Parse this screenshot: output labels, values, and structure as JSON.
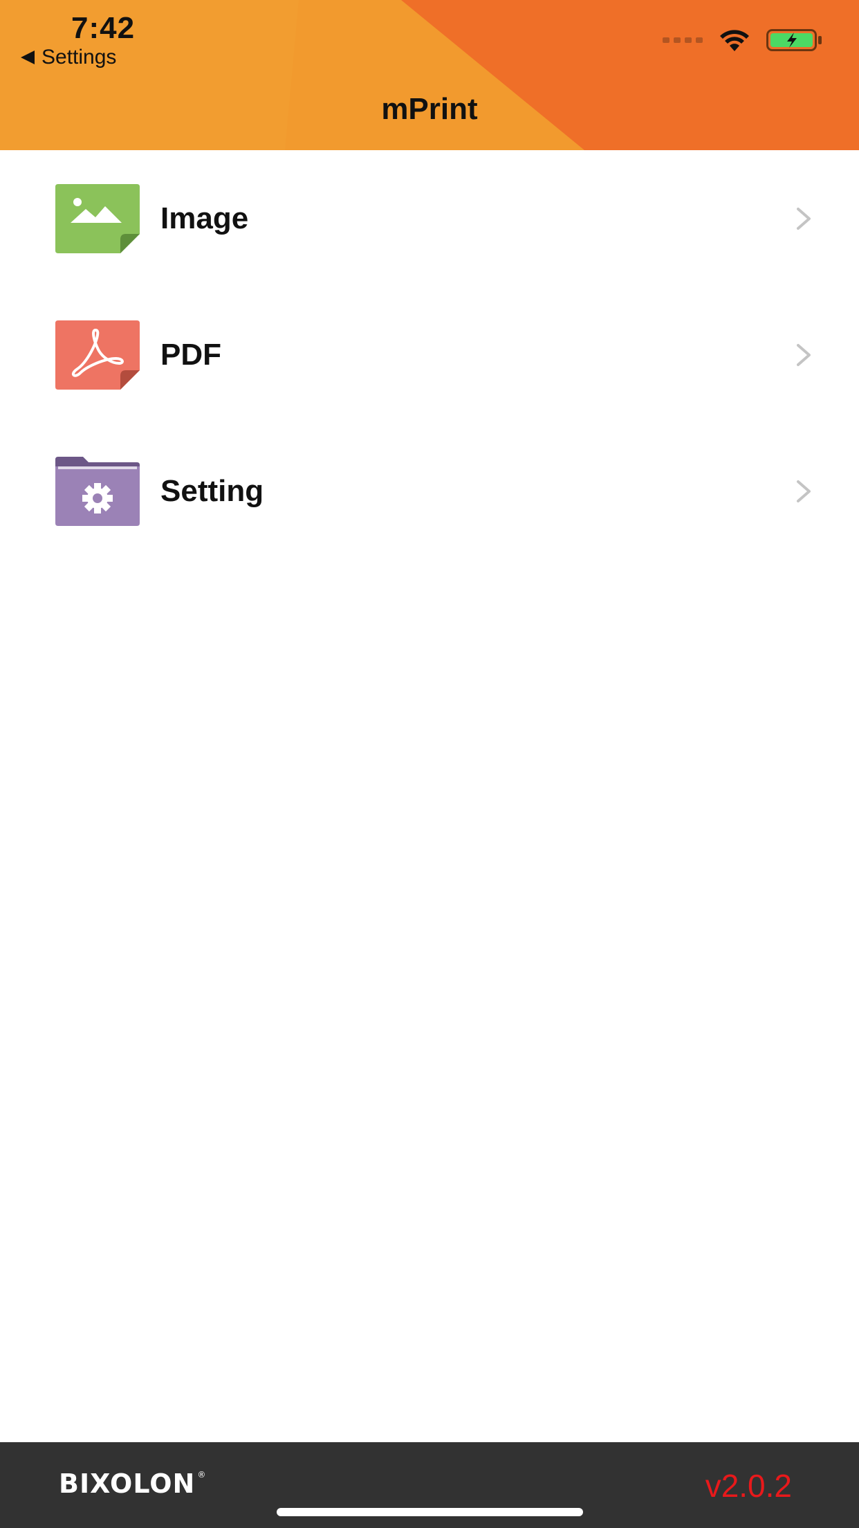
{
  "status_bar": {
    "time": "7:42",
    "back_label": "Settings",
    "signal_icon": "cellular-signal-dots-icon",
    "wifi_icon": "wifi-icon",
    "battery_icon": "battery-charging-icon"
  },
  "nav": {
    "title": "mPrint"
  },
  "menu": {
    "items": [
      {
        "label": "Image",
        "icon": "image-file-icon",
        "icon_color": "#8bc25a"
      },
      {
        "label": "PDF",
        "icon": "pdf-file-icon",
        "icon_color": "#ee7463"
      },
      {
        "label": "Setting",
        "icon": "settings-folder-icon",
        "icon_color": "#9b82b6"
      }
    ]
  },
  "footer": {
    "brand": "BIXOLON",
    "brand_mark": "®",
    "version": "v2.0.2"
  },
  "colors": {
    "header_orange_light": "#f29a2e",
    "header_orange_dark": "#ef6f28",
    "footer_bg": "#323232",
    "version_red": "#e8191b",
    "battery_green": "#4cd964"
  }
}
